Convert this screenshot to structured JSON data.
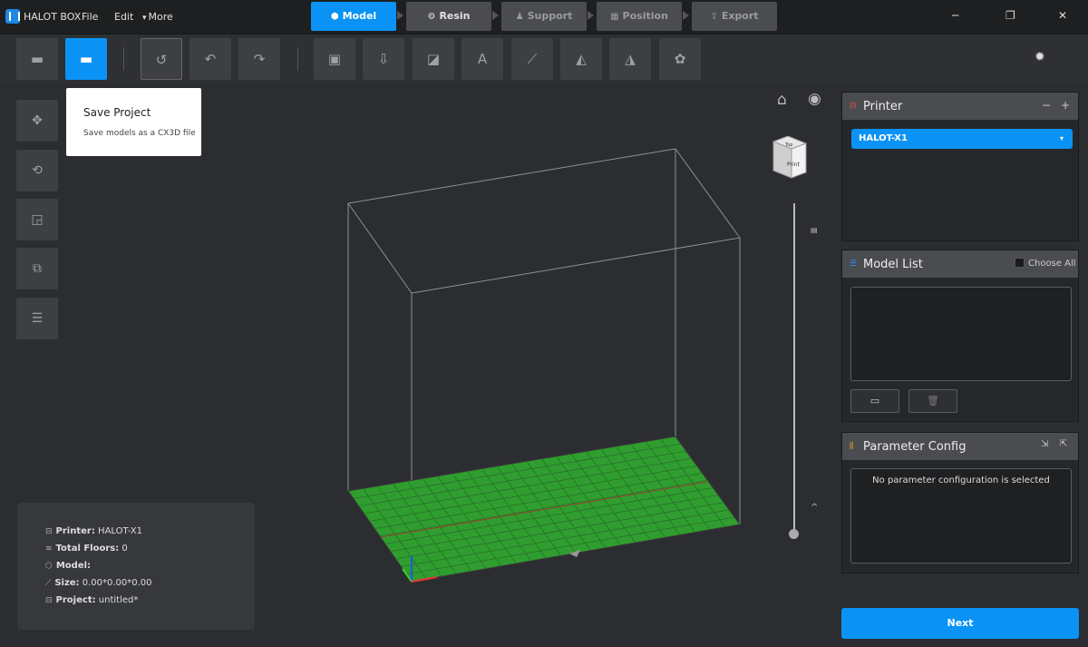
{
  "app": {
    "title": "HALOT BOX"
  },
  "menu": {
    "file": "File",
    "edit": "Edit",
    "more": "More",
    "more_arrow": "▾"
  },
  "steps": [
    {
      "label": "Model",
      "active": true
    },
    {
      "label": "Resin",
      "active": false
    },
    {
      "label": "Support",
      "active": false
    },
    {
      "label": "Position",
      "active": false
    },
    {
      "label": "Export",
      "active": false
    }
  ],
  "window": {
    "minimize": "─",
    "restore": "❐",
    "close": "✕"
  },
  "tooltip": {
    "title": "Save Project",
    "description": "Save models as a CX3D file"
  },
  "info": {
    "printer_label": "Printer:",
    "printer_value": "HALOT-X1",
    "floors_label": "Total Floors:",
    "floors_value": "0",
    "model_label": "Model:",
    "model_value": "",
    "size_label": "Size:",
    "size_value": "0.00*0.00*0.00",
    "project_label": "Project:",
    "project_value": "untitled*"
  },
  "printer_panel": {
    "title": "Printer",
    "selected": "HALOT-X1",
    "collapse": "−",
    "add": "+"
  },
  "model_list": {
    "title": "Model List",
    "choose_all": "Choose All"
  },
  "parameter_config": {
    "title": "Parameter Config",
    "empty_message": "No parameter configuration is selected"
  },
  "viewcube": {
    "top": "Top",
    "front": "Print"
  },
  "next_button": "Next",
  "colors": {
    "accent": "#0a93f5",
    "plate": "#2f9e2f",
    "printer_icon": "#e84c3d",
    "list_icon": "#2f8df5",
    "param_icon": "#f0a030"
  },
  "icons": [
    "open-file-icon",
    "save-project-icon",
    "reset-icon",
    "undo-icon",
    "redo-icon",
    "hollow-icon",
    "import-icon",
    "cut-icon",
    "text-icon",
    "measure-icon",
    "eraser-icon",
    "mirror-icon",
    "repair-icon",
    "settings-icon",
    "move-icon",
    "rotate-icon",
    "scale-icon",
    "duplicate-icon",
    "layout-icon",
    "home-icon",
    "eye-icon"
  ]
}
